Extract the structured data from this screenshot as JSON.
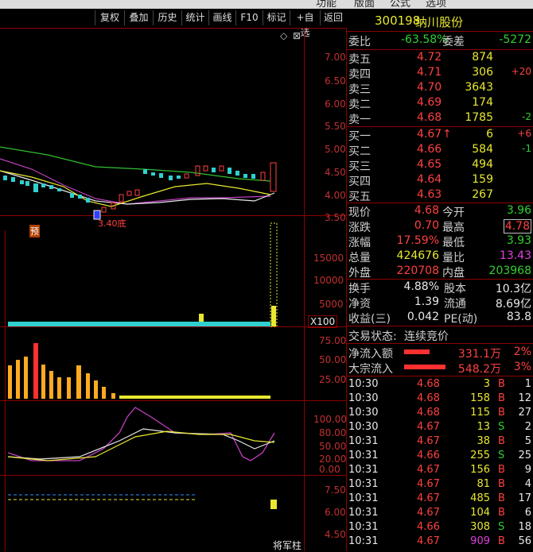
{
  "menu": {
    "items": [
      "功能",
      "版面",
      "公式",
      "选项"
    ]
  },
  "toolbar": {
    "buttons": [
      "复权",
      "叠加",
      "历史",
      "统计",
      "画线",
      "F10",
      "标记",
      "+自选",
      "返回"
    ]
  },
  "stock": {
    "code": "300198",
    "name": "纳川股份"
  },
  "price_axis": [
    "7.00",
    "6.50",
    "6.00",
    "5.50",
    "5.00",
    "4.50",
    "4.00",
    "3.50"
  ],
  "volume_axis": [
    "15000",
    "10000",
    "5000"
  ],
  "volume_unit": "X100",
  "panel3_axis": [
    "75.00",
    "50.00",
    "25.00"
  ],
  "panel4_axis": [
    "100.00",
    "80.00",
    "50.00",
    "20.00",
    "0.00"
  ],
  "panel5_axis": [
    "7.50",
    "6.00",
    "4.50"
  ],
  "chart_labels": {
    "low_price": "3.40",
    "low_tag": "底",
    "yu_tag": "预",
    "general_tag": "将军柱"
  },
  "order_ratio": {
    "label_ratio": "委比",
    "ratio": "-63.58%",
    "label_diff": "委差",
    "diff": "-5272"
  },
  "asks": [
    {
      "label": "卖五",
      "price": "4.72",
      "vol": "874",
      "chg": ""
    },
    {
      "label": "卖四",
      "price": "4.71",
      "vol": "306",
      "chg": "+20"
    },
    {
      "label": "卖三",
      "price": "4.70",
      "vol": "3643",
      "chg": ""
    },
    {
      "label": "卖二",
      "price": "4.69",
      "vol": "174",
      "chg": ""
    },
    {
      "label": "卖一",
      "price": "4.68",
      "vol": "1785",
      "chg": "-2"
    }
  ],
  "bids": [
    {
      "label": "买一",
      "price": "4.67",
      "arrow": "↑",
      "vol": "6",
      "chg": "+6"
    },
    {
      "label": "买二",
      "price": "4.66",
      "arrow": "",
      "vol": "584",
      "chg": "-1"
    },
    {
      "label": "买三",
      "price": "4.65",
      "arrow": "",
      "vol": "494",
      "chg": ""
    },
    {
      "label": "买四",
      "price": "4.64",
      "arrow": "",
      "vol": "159",
      "chg": ""
    },
    {
      "label": "买五",
      "price": "4.63",
      "arrow": "",
      "vol": "267",
      "chg": ""
    }
  ],
  "quote": [
    {
      "l1": "现价",
      "v1": "4.68",
      "c1": "red",
      "l2": "今开",
      "v2": "3.96",
      "c2": "green"
    },
    {
      "l1": "涨跌",
      "v1": "0.70",
      "c1": "red",
      "l2": "最高",
      "v2": "4.78",
      "c2": "red"
    },
    {
      "l1": "涨幅",
      "v1": "17.59%",
      "c1": "red",
      "l2": "最低",
      "v2": "3.93",
      "c2": "green"
    },
    {
      "l1": "总量",
      "v1": "424676",
      "c1": "yellow",
      "l2": "量比",
      "v2": "13.43",
      "c2": "magenta"
    },
    {
      "l1": "外盘",
      "v1": "220708",
      "c1": "red",
      "l2": "内盘",
      "v2": "203968",
      "c2": "green"
    }
  ],
  "fundamentals": [
    {
      "l1": "换手",
      "v1": "4.88%",
      "l2": "股本",
      "v2": "10.3亿"
    },
    {
      "l1": "净资",
      "v1": "1.39",
      "l2": "流通",
      "v2": "8.69亿"
    },
    {
      "l1": "收益(三)",
      "v1": "0.042",
      "l2": "PE(动)",
      "v2": "83.8"
    }
  ],
  "trade_status": {
    "label": "交易状态:",
    "value": "连续竞价"
  },
  "flows": [
    {
      "label": "净流入额",
      "value": "331.1万",
      "pct": "2%"
    },
    {
      "label": "大宗流入",
      "value": "548.2万",
      "pct": "3%"
    }
  ],
  "ticks": [
    {
      "time": "10:30",
      "price": "4.68",
      "vol": "3",
      "side": "B",
      "n": "1"
    },
    {
      "time": "10:30",
      "price": "4.68",
      "vol": "158",
      "side": "B",
      "n": "12"
    },
    {
      "time": "10:30",
      "price": "4.68",
      "vol": "115",
      "side": "B",
      "n": "27"
    },
    {
      "time": "10:30",
      "price": "4.67",
      "vol": "13",
      "side": "S",
      "n": "2"
    },
    {
      "time": "10:31",
      "price": "4.67",
      "vol": "38",
      "side": "B",
      "n": "5"
    },
    {
      "time": "10:31",
      "price": "4.66",
      "vol": "255",
      "side": "S",
      "n": "25"
    },
    {
      "time": "10:31",
      "price": "4.67",
      "vol": "156",
      "side": "B",
      "n": "9"
    },
    {
      "time": "10:31",
      "price": "4.67",
      "vol": "81",
      "side": "B",
      "n": "4"
    },
    {
      "time": "10:31",
      "price": "4.67",
      "vol": "485",
      "side": "B",
      "n": "17"
    },
    {
      "time": "10:31",
      "price": "4.67",
      "vol": "104",
      "side": "B",
      "n": "6"
    },
    {
      "time": "10:31",
      "price": "4.66",
      "vol": "308",
      "side": "S",
      "n": "18"
    },
    {
      "time": "10:31",
      "price": "4.67",
      "vol": "909",
      "side": "B",
      "n": "56"
    }
  ],
  "colors": {
    "up": "#ff4040",
    "down": "#30d030",
    "grid": "#8b0000",
    "ma_green": "#30c030",
    "ma_magenta": "#c040c0",
    "ma_yellow": "#e8e830",
    "ma_white": "#e8e8e8"
  }
}
